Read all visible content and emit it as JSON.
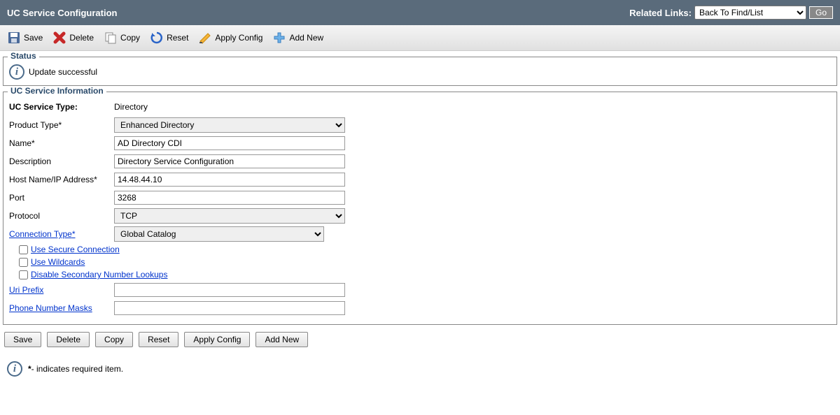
{
  "header": {
    "title": "UC Service Configuration",
    "related_links_label": "Related Links:",
    "related_links_selected": "Back To Find/List",
    "go_label": "Go"
  },
  "toolbar": {
    "save": "Save",
    "delete": "Delete",
    "copy": "Copy",
    "reset": "Reset",
    "apply_config": "Apply Config",
    "add_new": "Add New"
  },
  "status": {
    "legend": "Status",
    "message": "Update successful"
  },
  "form": {
    "legend": "UC Service Information",
    "service_type_label": "UC Service Type:",
    "service_type_value": "Directory",
    "product_type_label": "Product Type",
    "product_type_value": "Enhanced Directory",
    "name_label": "Name",
    "name_value": "AD Directory CDI",
    "description_label": "Description",
    "description_value": "Directory Service Configuration",
    "host_label": "Host Name/IP Address",
    "host_value": "14.48.44.10",
    "port_label": "Port",
    "port_value": "3268",
    "protocol_label": "Protocol",
    "protocol_value": "TCP",
    "connection_type_label": "Connection Type",
    "connection_type_value": "Global Catalog",
    "use_secure_label": "Use Secure Connection",
    "use_wildcards_label": "Use Wildcards",
    "disable_secondary_label": "Disable Secondary Number Lookups",
    "uri_prefix_label": "Uri Prefix",
    "uri_prefix_value": "",
    "phone_masks_label": "Phone Number Masks",
    "phone_masks_value": ""
  },
  "bottom": {
    "save": "Save",
    "delete": "Delete",
    "copy": "Copy",
    "reset": "Reset",
    "apply_config": "Apply Config",
    "add_new": "Add New"
  },
  "footer": {
    "required_note": "- indicates required item."
  }
}
